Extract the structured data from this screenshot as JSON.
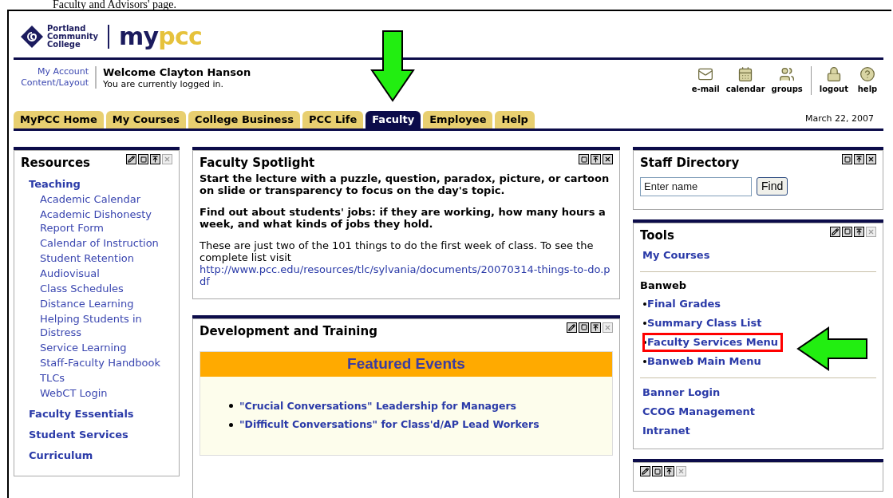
{
  "caption": "Faculty and Advisors' page.",
  "header": {
    "logo_lines": [
      "Portland",
      "Community",
      "College"
    ],
    "brand_a": "my",
    "brand_b": "pcc",
    "account_links": [
      "My Account",
      "Content/Layout"
    ],
    "welcome": "Welcome Clayton Hanson",
    "status": "You are currently logged in.",
    "tools": [
      {
        "kind": "mail",
        "label": "e-mail"
      },
      {
        "kind": "calendar",
        "label": "calendar"
      },
      {
        "kind": "groups",
        "label": "groups"
      },
      {
        "kind": "logout",
        "label": "logout"
      },
      {
        "kind": "help",
        "label": "help"
      }
    ],
    "tabs": [
      {
        "label": "MyPCC Home",
        "selected": false
      },
      {
        "label": "My Courses",
        "selected": false
      },
      {
        "label": "College Business",
        "selected": false
      },
      {
        "label": "PCC Life",
        "selected": false
      },
      {
        "label": "Faculty",
        "selected": true
      },
      {
        "label": "Employee",
        "selected": false
      },
      {
        "label": "Help",
        "selected": false
      }
    ],
    "date": "March 22, 2007"
  },
  "resources": {
    "title": "Resources",
    "sections": [
      {
        "title": "Teaching",
        "items": [
          "Academic Calendar",
          "Academic Dishonesty Report Form",
          "Calendar of Instruction",
          "Student Retention",
          "Audiovisual",
          "Class Schedules",
          "Distance Learning",
          "Helping Students in Distress",
          "Service Learning",
          "Staff-Faculty Handbook",
          "TLCs",
          "WebCT Login"
        ]
      },
      {
        "title": "Faculty Essentials"
      },
      {
        "title": "Student Services"
      },
      {
        "title": "Curriculum"
      }
    ]
  },
  "spotlight": {
    "title": "Faculty Spotlight",
    "tips": [
      "Start the lecture with a puzzle, question, paradox, picture, or cartoon on slide or transparency to focus on the day's topic.",
      "Find out about students' jobs: if they are working, how many hours a week, and what kinds of jobs they hold."
    ],
    "note": "These are just two of the 101 things to do the first week of class. To see the complete list visit",
    "link": "http://www.pcc.edu/resources/tlc/sylvania/documents/20070314-things-to-do.pdf"
  },
  "development": {
    "title": "Development and Training",
    "featured_title": "Featured Events",
    "events": [
      "\"Crucial Conversations\" Leadership for Managers",
      "\"Difficult Conversations\" for Class'd/AP Lead Workers"
    ]
  },
  "staff_directory": {
    "title": "Staff Directory",
    "placeholder": "Enter name",
    "button": "Find"
  },
  "tools_panel": {
    "title": "Tools",
    "groups": [
      {
        "links": [
          {
            "label": "My Courses",
            "bullet": false,
            "highlighted": false
          }
        ]
      },
      {
        "heading": "Banweb",
        "links": [
          {
            "label": "Final Grades",
            "bullet": true,
            "highlighted": false
          },
          {
            "label": "Summary Class List",
            "bullet": true,
            "highlighted": false
          },
          {
            "label": "Faculty Services Menu",
            "bullet": true,
            "highlighted": true
          },
          {
            "label": "Banweb Main Menu",
            "bullet": true,
            "highlighted": false
          }
        ]
      },
      {
        "links": [
          {
            "label": "Banner Login",
            "bullet": false,
            "highlighted": false
          },
          {
            "label": "CCOG Management",
            "bullet": false,
            "highlighted": false
          },
          {
            "label": "Intranet",
            "bullet": false,
            "highlighted": false
          }
        ]
      }
    ]
  }
}
